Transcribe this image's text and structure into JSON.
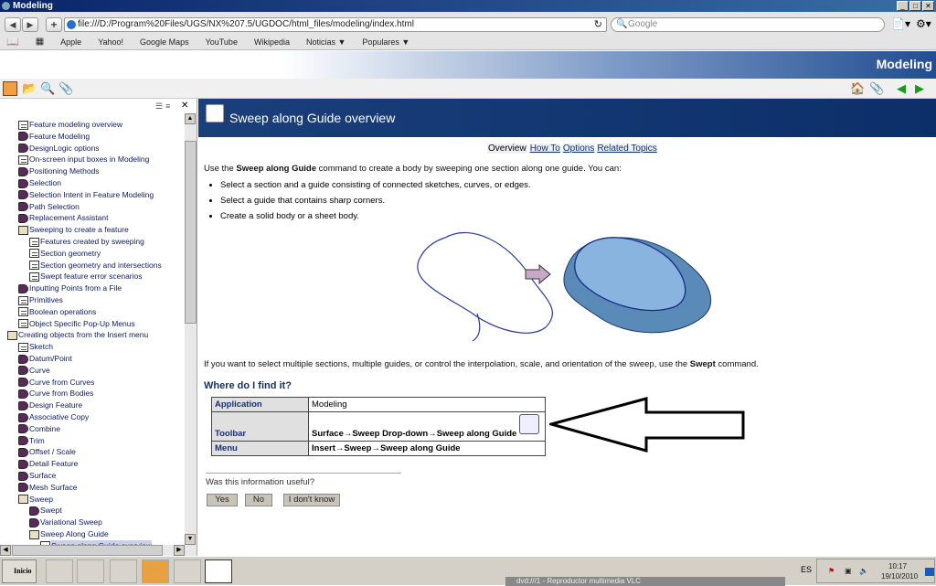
{
  "window": {
    "title": "Modeling"
  },
  "browser": {
    "url": "file:///D:/Program%20Files/UGS/NX%207.5/UGDOC/html_files/modeling/index.html",
    "search_placeholder": "Google",
    "bookmarks": [
      "Apple",
      "Yahoo!",
      "Google Maps",
      "YouTube",
      "Wikipedia",
      "Noticias ▼",
      "Populares ▼"
    ]
  },
  "banner": {
    "title": "Modeling"
  },
  "tree": [
    {
      "label": "Feature modeling overview",
      "icon": "page",
      "level": 1
    },
    {
      "label": "Feature Modeling",
      "icon": "book",
      "level": 1
    },
    {
      "label": "DesignLogic options",
      "icon": "book",
      "level": 1
    },
    {
      "label": "On-screen input boxes in Modeling",
      "icon": "page",
      "level": 1
    },
    {
      "label": "Positioning Methods",
      "icon": "book",
      "level": 1
    },
    {
      "label": "Selection",
      "icon": "book",
      "level": 1
    },
    {
      "label": "Selection Intent in Feature Modeling",
      "icon": "book",
      "level": 1
    },
    {
      "label": "Path Selection",
      "icon": "book",
      "level": 1
    },
    {
      "label": "Replacement Assistant",
      "icon": "book",
      "level": 1
    },
    {
      "label": "Sweeping to create a feature",
      "icon": "open",
      "level": 1
    },
    {
      "label": "Features created by sweeping",
      "icon": "page",
      "level": 2
    },
    {
      "label": "Section geometry",
      "icon": "page",
      "level": 2
    },
    {
      "label": "Section geometry and intersections",
      "icon": "page",
      "level": 2
    },
    {
      "label": "Swept feature error scenarios",
      "icon": "page",
      "level": 2
    },
    {
      "label": "Inputting Points from a File",
      "icon": "book",
      "level": 1
    },
    {
      "label": "Primitives",
      "icon": "page",
      "level": 1
    },
    {
      "label": "Boolean operations",
      "icon": "page",
      "level": 1
    },
    {
      "label": "Object Specific Pop-Up Menus",
      "icon": "page",
      "level": 1
    },
    {
      "label": "Creating objects from the Insert menu",
      "icon": "open",
      "level": 0
    },
    {
      "label": "Sketch",
      "icon": "page",
      "level": 1
    },
    {
      "label": "Datum/Point",
      "icon": "book",
      "level": 1
    },
    {
      "label": "Curve",
      "icon": "book",
      "level": 1
    },
    {
      "label": "Curve from Curves",
      "icon": "book",
      "level": 1
    },
    {
      "label": "Curve from Bodies",
      "icon": "book",
      "level": 1
    },
    {
      "label": "Design Feature",
      "icon": "book",
      "level": 1
    },
    {
      "label": "Associative Copy",
      "icon": "book",
      "level": 1
    },
    {
      "label": "Combine",
      "icon": "book",
      "level": 1
    },
    {
      "label": "Trim",
      "icon": "book",
      "level": 1
    },
    {
      "label": "Offset / Scale",
      "icon": "book",
      "level": 1
    },
    {
      "label": "Detail Feature",
      "icon": "book",
      "level": 1
    },
    {
      "label": "Surface",
      "icon": "book",
      "level": 1
    },
    {
      "label": "Mesh Surface",
      "icon": "book",
      "level": 1
    },
    {
      "label": "Sweep",
      "icon": "open",
      "level": 1
    },
    {
      "label": "Swept",
      "icon": "book",
      "level": 2
    },
    {
      "label": "Variational Sweep",
      "icon": "book",
      "level": 2
    },
    {
      "label": "Sweep Along Guide",
      "icon": "open",
      "level": 2
    },
    {
      "label": "Sweep along Guide overview",
      "icon": "page",
      "level": 3,
      "selected": true
    }
  ],
  "page": {
    "title": "Sweep along Guide overview",
    "tabs": {
      "current": "Overview",
      "links": [
        "How To",
        "Options",
        "Related Topics"
      ]
    },
    "intro": {
      "pre": "Use the ",
      "bold": "Sweep along Guide",
      "post": " command to create a body by sweeping one section along one guide. You can:"
    },
    "bullets": [
      "Select a section and a guide consisting of connected sketches, curves, or edges.",
      "Select a guide that contains sharp corners.",
      "Create a solid body or a sheet body."
    ],
    "para2": {
      "pre": "If you want to select multiple sections, multiple guides, or control the interpolation, scale, and orientation of the sweep, use the ",
      "bold": "Swept",
      "post": " command."
    },
    "where_heading": "Where do I find it?",
    "table": [
      {
        "k": "Application",
        "v": "Modeling"
      },
      {
        "k": "Toolbar",
        "v": "Surface→Sweep Drop-down→Sweep along Guide"
      },
      {
        "k": "Menu",
        "v": "Insert→Sweep→Sweep along Guide"
      }
    ],
    "feedback": {
      "question": "Was this information useful?",
      "yes": "Yes",
      "no": "No",
      "dontknow": "I don't know"
    }
  },
  "taskbar": {
    "start": "Inicio",
    "lang": "ES",
    "time": "10:17",
    "date": "19/10/2010",
    "task": "dvd:///1 - Reproductor multimedia VLC"
  }
}
